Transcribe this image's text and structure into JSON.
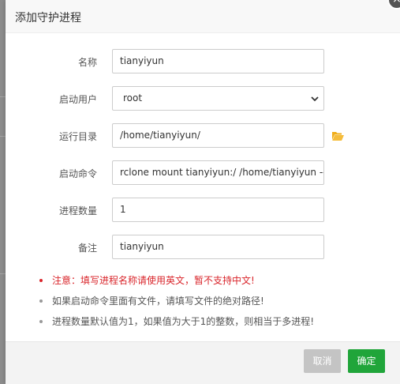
{
  "dialog": {
    "title": "添加守护进程",
    "close_symbol": "×"
  },
  "form": {
    "name": {
      "label": "名称",
      "value": "tianyiyun"
    },
    "user": {
      "label": "启动用户",
      "value": "root"
    },
    "run_dir": {
      "label": "运行目录",
      "value": "/home/tianyiyun/"
    },
    "command": {
      "label": "启动命令",
      "value": "rclone mount tianyiyun:/ /home/tianyiyun --cache-dir"
    },
    "process_count": {
      "label": "进程数量",
      "value": "1"
    },
    "remark": {
      "label": "备注",
      "value": "tianyiyun"
    }
  },
  "notes": [
    "注意：填写进程名称请使用英文，暂不支持中文!",
    "如果启动命令里面有文件，请填写文件的绝对路径!",
    "进程数量默认值为1，如果值为大于1的整数，则相当于多进程!"
  ],
  "footer": {
    "cancel_label": "取消",
    "ok_label": "确定"
  },
  "colors": {
    "primary": "#20a53a",
    "cancel": "#c4c4c4",
    "warning": "#d9252b",
    "folder": "#f0ad1a"
  }
}
